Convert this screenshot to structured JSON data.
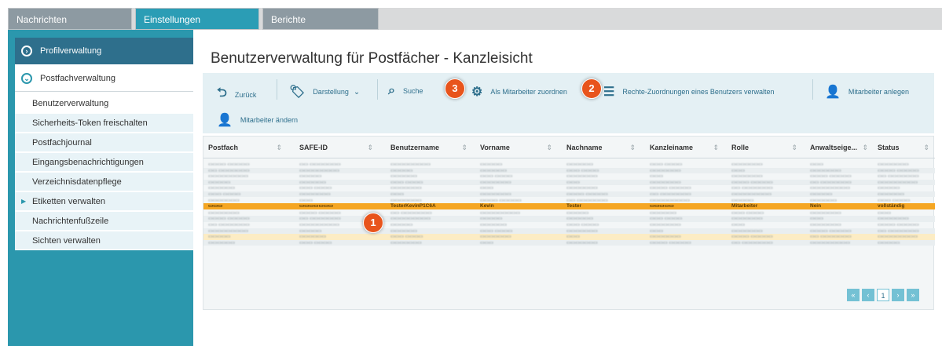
{
  "tabs": [
    "Nachrichten",
    "Einstellungen",
    "Berichte"
  ],
  "sidebar": {
    "section1": "Profilverwaltung",
    "section2": "Postfachverwaltung",
    "items": [
      "Benutzerverwaltung",
      "Sicherheits-Token freischalten",
      "Postfachjournal",
      "Eingangsbenachrichtigungen",
      "Verzeichnisdatenpflege",
      "Etiketten verwalten",
      "Nachrichtenfußzeile",
      "Sichten verwalten"
    ]
  },
  "title": "Benutzerverwaltung für Postfächer - Kanzleisicht",
  "toolbar": {
    "back": "Zurück",
    "display": "Darstellung",
    "search": "Suche",
    "assign": "Als Mitarbeiter zuordnen",
    "rights": "Rechte-Zuordnungen eines Benutzers verwalten",
    "create": "Mitarbeiter anlegen",
    "edit": "Mitarbeiter ändern"
  },
  "table": {
    "columns": [
      "Postfach",
      "SAFE-ID",
      "Benutzername",
      "Vorname",
      "Nachname",
      "Kanzleiname",
      "Rolle",
      "Anwaltseige...",
      "Status"
    ],
    "highlight_row": {
      "benutzername": "TesterKevinP1C6A",
      "vorname": "Kevin",
      "nachname": "Tester",
      "rolle": "Mitarbeiter",
      "anwalt": "Nein",
      "status": "vollständig"
    }
  },
  "pager": {
    "current_page": "1",
    "first": "«",
    "prev": "‹",
    "next": "›",
    "last": "»"
  },
  "badges": [
    "1",
    "2",
    "3"
  ],
  "colors": {
    "teal": "#2b97ad",
    "dark_teal": "#2e6f8c",
    "highlight": "#f5a623",
    "badge": "#e8541c"
  }
}
